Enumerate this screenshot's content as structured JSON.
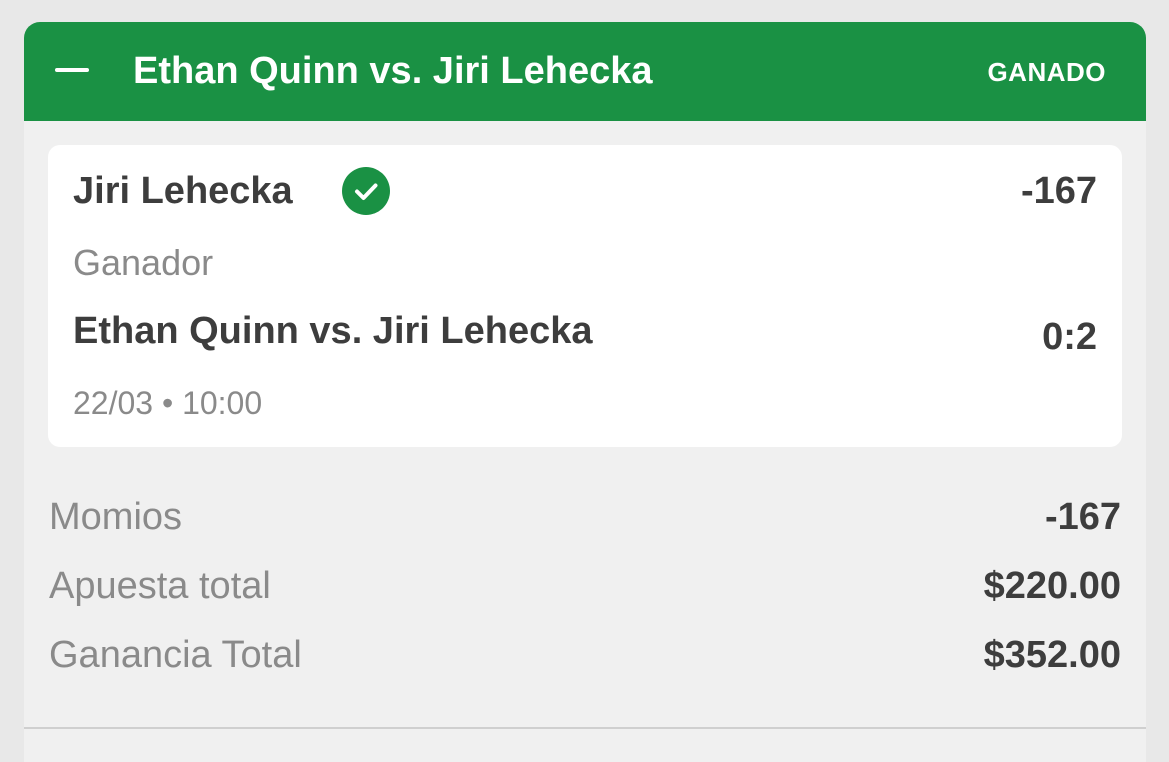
{
  "header": {
    "title": "Ethan Quinn vs. Jiri Lehecka",
    "status": "GANADO",
    "collapse_icon": "minus-icon"
  },
  "selection": {
    "name": "Jiri Lehecka",
    "odds": "-167",
    "market": "Ganador",
    "event": "Ethan Quinn vs. Jiri Lehecka",
    "score": "0:2",
    "datetime": "22/03 • 10:00",
    "status_icon": "check-circle-icon"
  },
  "summary": [
    {
      "label": "Momios",
      "value": "-167"
    },
    {
      "label": "Apuesta total",
      "value": "$220.00"
    },
    {
      "label": "Ganancia Total",
      "value": "$352.00"
    }
  ],
  "colors": {
    "accent": "#1a9144",
    "background": "#f0f0f0",
    "card": "#ffffff",
    "text_primary": "#3d3d3d",
    "text_secondary": "#8a8a8a"
  }
}
